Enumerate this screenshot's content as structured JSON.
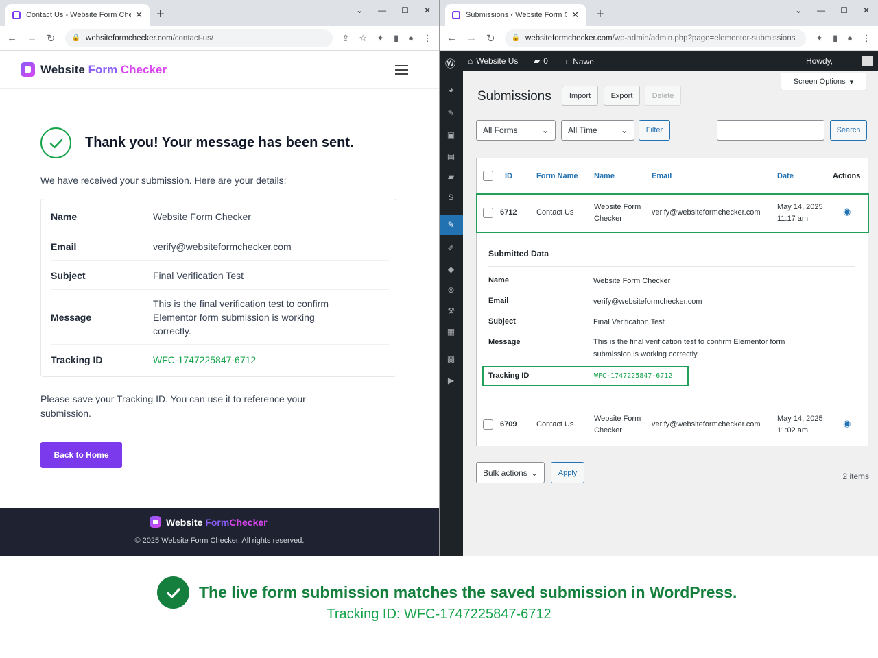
{
  "left": {
    "tab_title": "Contact Us - Website Form Chec",
    "url_domain": "websiteformchecker.com",
    "url_path": "/contact-us/",
    "logo": {
      "website": "Website",
      "form": "Form",
      "checker": "Checker"
    },
    "thanks_title": "Thank you! Your message has been sent.",
    "intro": "We have received your submission. Here are your details:",
    "details": [
      {
        "label": "Name",
        "value": "Website Form Checker"
      },
      {
        "label": "Email",
        "value": "verify@websiteformchecker.com"
      },
      {
        "label": "Subject",
        "value": "Final Verification Test"
      },
      {
        "label": "Message",
        "value": "This is the final verification test to confirm Elementor form submission is working correctly."
      },
      {
        "label": "Tracking ID",
        "value": "WFC-1747225847-6712"
      }
    ],
    "save_note": "Please save your Tracking ID. You can use it to reference your submission.",
    "back_button": "Back to Home",
    "footer_copyright": "© 2025 Website Form Checker. All rights reserved."
  },
  "right": {
    "tab_title": "Submissions ‹ Website Form Chec",
    "url_domain": "websiteformchecker.com",
    "url_path": "/wp-admin/admin.php?page=elementor-submissions",
    "adminbar": {
      "site": "Website Us",
      "comments": "0",
      "new": "Nawe",
      "howdy": "Howdy,"
    },
    "screen_options": "Screen Options",
    "page_title": "Submissions",
    "buttons": {
      "import": "Import",
      "export": "Export",
      "delete": "Delete",
      "filter": "Filter",
      "search": "Search",
      "apply": "Apply"
    },
    "filters": {
      "forms": "All Forms",
      "time": "All Time",
      "bulk": "Bulk actions"
    },
    "columns": [
      "ID",
      "Form Name",
      "Name",
      "Email",
      "Date",
      "Actions"
    ],
    "rows": [
      {
        "id": "6712",
        "form": "Contact Us",
        "name_1": "Website Form",
        "name_2": "Checker",
        "email": "verify@websiteformchecker.com",
        "date_1": "May 14, 2025",
        "date_2": "11:17 am"
      },
      {
        "id": "6709",
        "form": "Contact Us",
        "name_1": "Website Form",
        "name_2": "Checker",
        "email": "verify@websiteformchecker.com",
        "date_1": "May 14, 2025",
        "date_2": "11:02 am"
      }
    ],
    "submitted_title": "Submitted Data",
    "submitted": [
      {
        "label": "Name",
        "value": "Website Form Checker"
      },
      {
        "label": "Email",
        "value": "verify@websiteformchecker.com"
      },
      {
        "label": "Subject",
        "value": "Final Verification Test"
      },
      {
        "label": "Message",
        "value": "This is the final verification test to confirm Elementor form submission is working correctly."
      },
      {
        "label": "Tracking ID",
        "value": "WFC-1747225847-6712"
      }
    ],
    "items_count": "2 items"
  },
  "caption": {
    "headline": "The live form submission matches the saved submission in WordPress.",
    "tracking": "Tracking ID: WFC-1747225847-6712"
  },
  "colors": {
    "brand_purple": "#7c3aed",
    "success_green": "#16a34a",
    "wp_blue": "#2271b1",
    "wp_dark": "#1d2327"
  }
}
